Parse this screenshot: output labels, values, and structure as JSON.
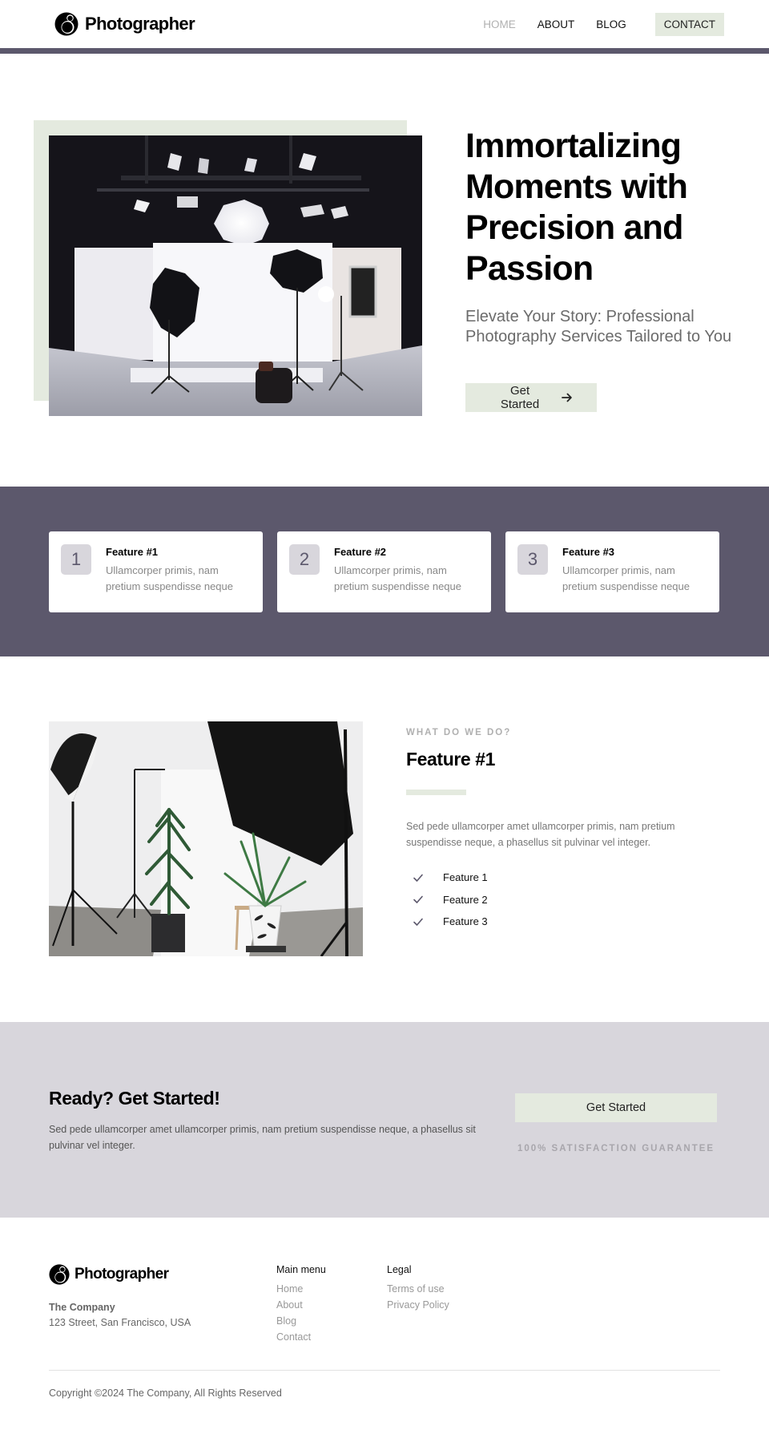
{
  "colors": {
    "accent_purple": "#5c586c",
    "accent_sage": "#e4eadf",
    "cta_bg": "#d8d6dc"
  },
  "nav": {
    "brand": "Photographer",
    "logo_icon": "camera-lens-logo-icon",
    "items": [
      {
        "label": "HOME",
        "active": true
      },
      {
        "label": "ABOUT",
        "active": false
      },
      {
        "label": "BLOG",
        "active": false
      },
      {
        "label": "CONTACT",
        "active": false
      }
    ]
  },
  "hero": {
    "title": "Immortalizing Moments with Precision and Passion",
    "subtitle": "Elevate Your Story: Professional Photography Services Tailored to You",
    "cta_label": "Get Started",
    "cta_icon": "arrow-right-icon",
    "image_alt": "Photography studio with softbox lights and white backdrop"
  },
  "features": [
    {
      "number": "1",
      "title": "Feature #1",
      "description": "Ullamcorper primis, nam pretium suspendisse neque"
    },
    {
      "number": "2",
      "title": "Feature #2",
      "description": "Ullamcorper primis, nam pretium suspendisse neque"
    },
    {
      "number": "3",
      "title": "Feature #3",
      "description": "Ullamcorper primis, nam pretium suspendisse neque"
    }
  ],
  "detail": {
    "eyebrow": "WHAT DO WE DO?",
    "title": "Feature #1",
    "description": "Sed pede ullamcorper amet ullamcorper primis, nam pretium suspendisse neque, a phasellus sit pulvinar vel integer.",
    "checklist": [
      "Feature 1",
      "Feature 2",
      "Feature 3"
    ],
    "image_alt": "Studio with lights, umbrella and potted plants"
  },
  "cta": {
    "title": "Ready? Get Started!",
    "description": "Sed pede ullamcorper amet ullamcorper primis, nam pretium suspendisse neque, a phasellus sit pulvinar vel integer.",
    "button_label": "Get Started",
    "guarantee": "100% SATISFACTION GUARANTEE"
  },
  "footer": {
    "brand": "Photographer",
    "company": "The Company",
    "address": "123 Street, San Francisco, USA",
    "main_menu": {
      "heading": "Main menu",
      "links": [
        "Home",
        "About",
        "Blog",
        "Contact"
      ]
    },
    "legal": {
      "heading": "Legal",
      "links": [
        "Terms of use",
        "Privacy Policy"
      ]
    },
    "copyright": "Copyright ©2024 The Company, All Rights Reserved"
  }
}
